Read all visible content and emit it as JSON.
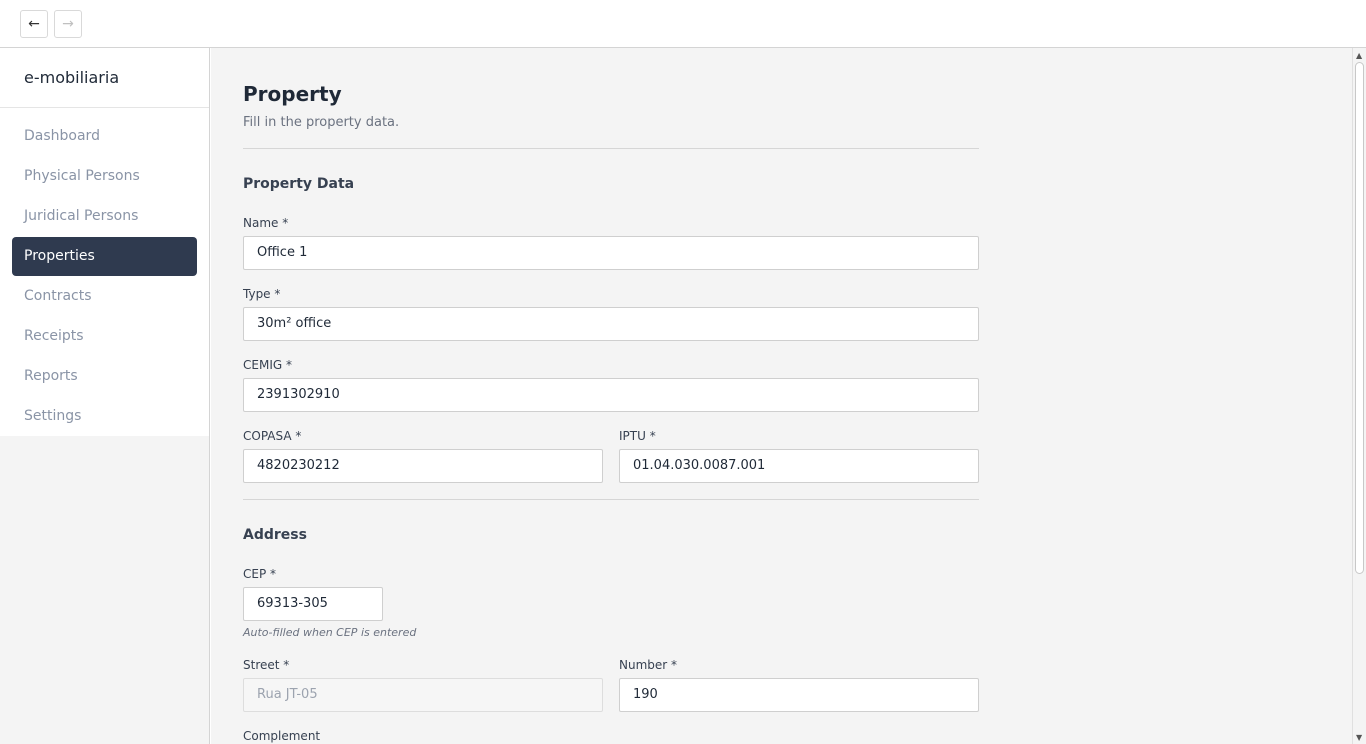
{
  "nav": {
    "back_icon": "←",
    "forward_icon": "→"
  },
  "sidebar": {
    "brand": "e-mobiliaria",
    "items": [
      {
        "label": "Dashboard"
      },
      {
        "label": "Physical Persons"
      },
      {
        "label": "Juridical Persons"
      },
      {
        "label": "Properties",
        "active": true
      },
      {
        "label": "Contracts"
      },
      {
        "label": "Receipts"
      },
      {
        "label": "Reports"
      },
      {
        "label": "Settings"
      }
    ]
  },
  "page": {
    "title": "Property",
    "subtitle": "Fill in the property data."
  },
  "property_data": {
    "section_title": "Property Data",
    "name": {
      "label": "Name *",
      "value": "Office 1"
    },
    "type": {
      "label": "Type *",
      "value": "30m² office"
    },
    "cemig": {
      "label": "CEMIG *",
      "value": "2391302910"
    },
    "copasa": {
      "label": "COPASA *",
      "value": "4820230212"
    },
    "iptu": {
      "label": "IPTU *",
      "value": "01.04.030.0087.001"
    }
  },
  "address": {
    "section_title": "Address",
    "cep": {
      "label": "CEP *",
      "value": "69313-305",
      "hint": "Auto-filled when CEP is entered"
    },
    "street": {
      "label": "Street *",
      "value": "Rua JT-05"
    },
    "number": {
      "label": "Number *",
      "value": "190"
    },
    "complement": {
      "label": "Complement"
    }
  },
  "colors": {
    "active_nav": "#2f3a4f",
    "background": "#f4f4f4"
  }
}
